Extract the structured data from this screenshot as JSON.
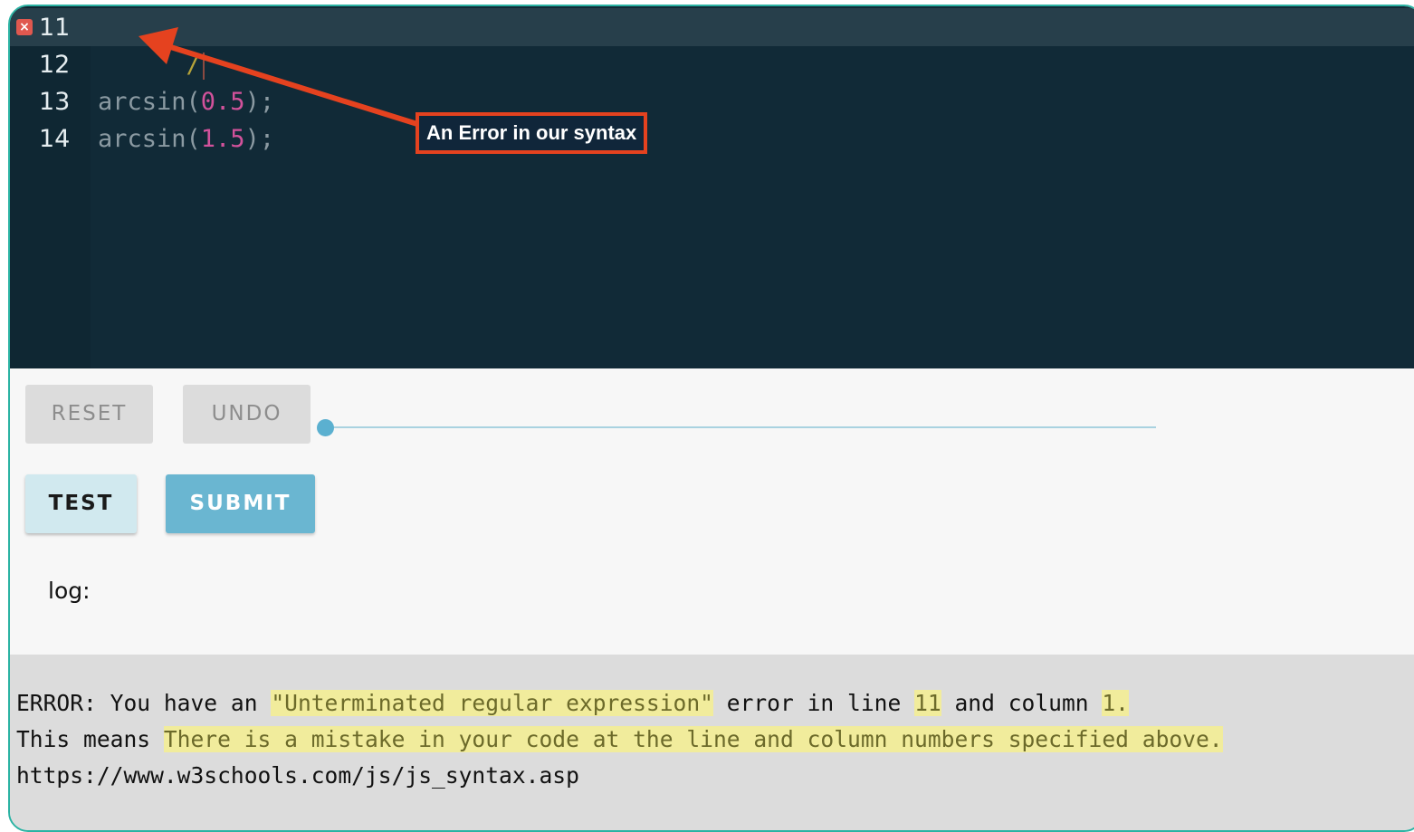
{
  "editor": {
    "lines": [
      {
        "number": "11",
        "code": "/"
      },
      {
        "number": "12",
        "code": ""
      },
      {
        "number": "13",
        "fn": "arcsin(",
        "arg": "0.5",
        "end": ");"
      },
      {
        "number": "14",
        "fn": "arcsin(",
        "arg": "1.5",
        "end": ");"
      }
    ],
    "error_marker": "×",
    "colors": {
      "background": "#112a37",
      "number": "#d2529b",
      "code": "#8b9aa2"
    }
  },
  "annotation": {
    "text": "An Error in our syntax",
    "color": "#e5421f"
  },
  "buttons": {
    "reset": "RESET",
    "undo": "UNDO",
    "test": "TEST",
    "submit": "SUBMIT"
  },
  "slider": {
    "value": 0
  },
  "log": {
    "label": "log:",
    "line1": {
      "prefix": "ERROR: You have an ",
      "error_type": "\"Unterminated regular expression\"",
      "mid": " error in line ",
      "line": "11",
      "and": " and column ",
      "column": "1."
    },
    "line2": {
      "prefix": "This means ",
      "explanation": "There is a mistake in your code at the line and column numbers specified above."
    },
    "line3": "https://www.w3schools.com/js/js_syntax.asp"
  }
}
